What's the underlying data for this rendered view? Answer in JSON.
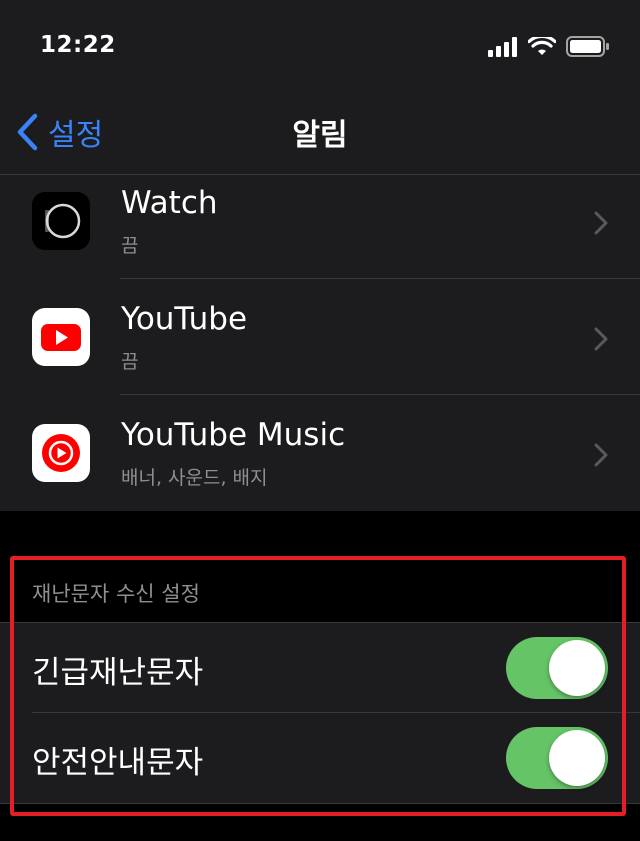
{
  "status_bar": {
    "time": "12:22"
  },
  "nav": {
    "back_label": "설정",
    "title": "알림"
  },
  "apps": [
    {
      "name": "Watch",
      "subtitle": "끔"
    },
    {
      "name": "YouTube",
      "subtitle": "끔"
    },
    {
      "name": "YouTube Music",
      "subtitle": "배너, 사운드, 배지"
    }
  ],
  "disaster_section": {
    "header": "재난문자 수신 설정",
    "items": [
      {
        "label": "긴급재난문자",
        "enabled": true
      },
      {
        "label": "안전안내문자",
        "enabled": true
      }
    ]
  },
  "colors": {
    "accent": "#3a82f7",
    "toggle_on": "#65c466",
    "highlight": "#e31e24",
    "youtube_red": "#ff0000"
  }
}
